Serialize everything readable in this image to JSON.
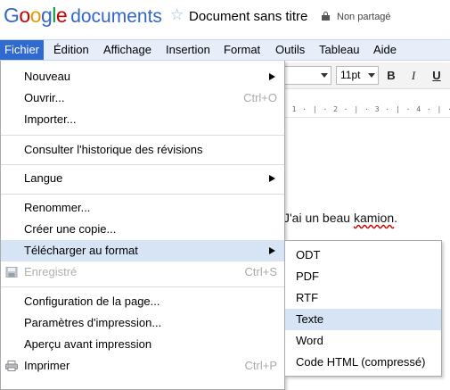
{
  "header": {
    "logo_letters": [
      "G",
      "o",
      "o",
      "g",
      "l",
      "e"
    ],
    "product": "documents",
    "doc_title": "Document sans titre",
    "share_status": "Non partagé"
  },
  "menubar": {
    "items": [
      "Fichier",
      "Édition",
      "Affichage",
      "Insertion",
      "Format",
      "Outils",
      "Tableau",
      "Aide"
    ],
    "active": "Fichier"
  },
  "toolbar": {
    "font_size": "11pt",
    "bold": "B",
    "italic": "I",
    "underline": "U"
  },
  "ruler": "· 1 · | · 2 · | · 3 · | · 4 · | · 5 · | · 6",
  "document": {
    "text_before": "J'ai un beau ",
    "text_misspelled": "kamion",
    "text_after": "."
  },
  "file_menu": {
    "items": [
      {
        "label": "Nouveau",
        "submenu": true
      },
      {
        "label": "Ouvrir...",
        "shortcut": "Ctrl+O"
      },
      {
        "label": "Importer..."
      },
      {
        "label": "Consulter l'historique des révisions"
      },
      {
        "label": "Langue",
        "submenu": true
      },
      {
        "label": "Renommer..."
      },
      {
        "label": "Créer une copie..."
      },
      {
        "label": "Télécharger au format",
        "submenu": true,
        "highlighted": true
      },
      {
        "label": "Enregistré",
        "shortcut": "Ctrl+S",
        "disabled": true,
        "icon": "save-icon"
      },
      {
        "label": "Configuration de la page..."
      },
      {
        "label": "Paramètres d'impression..."
      },
      {
        "label": "Aperçu avant impression"
      },
      {
        "label": "Imprimer",
        "shortcut": "Ctrl+P",
        "icon": "printer-icon"
      }
    ]
  },
  "download_submenu": {
    "items": [
      "ODT",
      "PDF",
      "RTF",
      "Texte",
      "Word",
      "Code HTML (compressé)"
    ],
    "highlighted": "Texte"
  },
  "colors": {
    "menubar_bg": "#e7eefa",
    "active_menu": "#2f6ad0",
    "highlight": "#d6e4f6",
    "title_blue": "#3366cc"
  }
}
